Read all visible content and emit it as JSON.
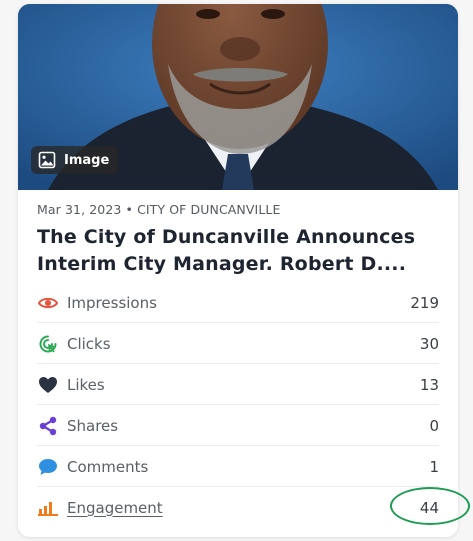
{
  "post": {
    "media_type_label": "Image",
    "date": "Mar 31, 2023",
    "separator": "•",
    "source": "CITY OF DUNCANVILLE",
    "title": "The City of Duncanville Announces Interim City Manager. Robert D...."
  },
  "stats": [
    {
      "icon": "eye-icon",
      "label": "Impressions",
      "value": "219",
      "color": "#e5533d"
    },
    {
      "icon": "cursor-click-icon",
      "label": "Clicks",
      "value": "30",
      "color": "#2eaa57"
    },
    {
      "icon": "heart-icon",
      "label": "Likes",
      "value": "13",
      "color": "#2b3244"
    },
    {
      "icon": "share-icon",
      "label": "Shares",
      "value": "0",
      "color": "#6b3fd4"
    },
    {
      "icon": "comment-icon",
      "label": "Comments",
      "value": "1",
      "color": "#2f8fe0"
    },
    {
      "icon": "bar-chart-icon",
      "label": "Engagement",
      "value": "44",
      "color": "#f07c1e"
    }
  ],
  "colors": {
    "highlight_ring": "#1e9c54",
    "title_text": "#1e2430"
  }
}
